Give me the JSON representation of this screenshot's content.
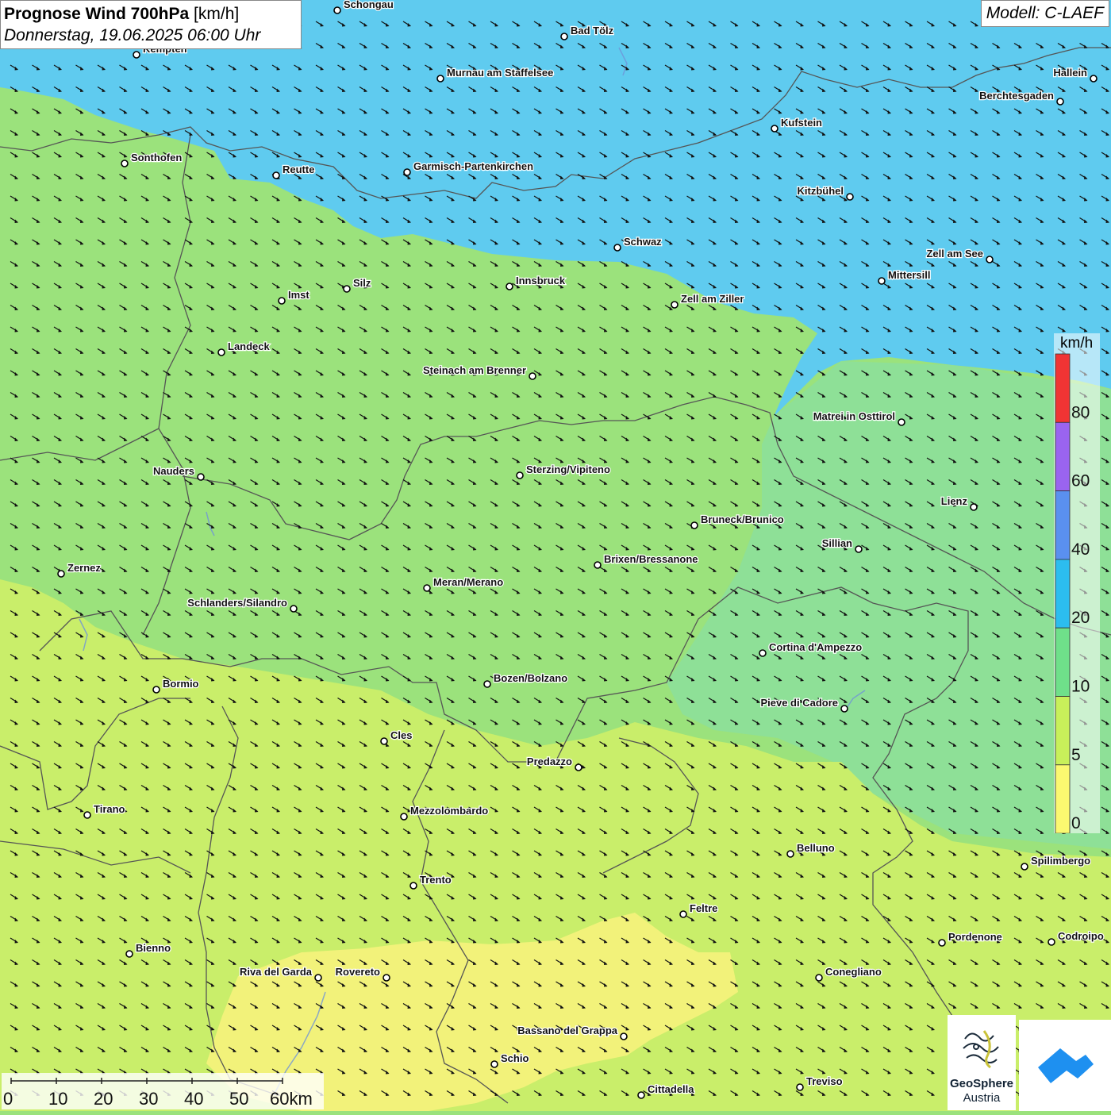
{
  "title": {
    "bold": "Prognose Wind 700hPa",
    "unit": "[km/h]",
    "date": "Donnerstag, 19.06.2025 06:00 Uhr"
  },
  "model": "Modell: C-LAEF",
  "legend": {
    "unit": "km/h",
    "ticks": [
      "80",
      "60",
      "40",
      "20",
      "10",
      "5",
      "0"
    ],
    "colors": [
      "#f03434",
      "#9a64f0",
      "#5a90ef",
      "#2cbdef",
      "#6fe08a",
      "#c8f05a",
      "#fbf870"
    ]
  },
  "scalebar": {
    "ticks": [
      "0",
      "10",
      "20",
      "30",
      "40",
      "50",
      "60km"
    ]
  },
  "logo": {
    "line1": "GeoSphere",
    "line2": "Austria"
  },
  "cities": [
    {
      "name": "Schongau"
    },
    {
      "name": "Bad Tölz"
    },
    {
      "name": "Kempten"
    },
    {
      "name": "Murnau am Staffelsee"
    },
    {
      "name": "Hallein"
    },
    {
      "name": "Berchtesgaden"
    },
    {
      "name": "Kufstein"
    },
    {
      "name": "Sonthofen"
    },
    {
      "name": "Reutte"
    },
    {
      "name": "Garmisch-Partenkirchen"
    },
    {
      "name": "Kitzbühel"
    },
    {
      "name": "Schwaz"
    },
    {
      "name": "Zell am See"
    },
    {
      "name": "Mittersill"
    },
    {
      "name": "Innsbruck"
    },
    {
      "name": "Silz"
    },
    {
      "name": "Imst"
    },
    {
      "name": "Zell am Ziller"
    },
    {
      "name": "Landeck"
    },
    {
      "name": "Steinach am Brenner"
    },
    {
      "name": "Matrei in Osttirol"
    },
    {
      "name": "Nauders"
    },
    {
      "name": "Sterzing/Vipiteno"
    },
    {
      "name": "Lienz"
    },
    {
      "name": "Bruneck/Brunico"
    },
    {
      "name": "Sillian"
    },
    {
      "name": "Brixen/Bressanone"
    },
    {
      "name": "Zernez"
    },
    {
      "name": "Meran/Merano"
    },
    {
      "name": "Schlanders/Silandro"
    },
    {
      "name": "Cortina d'Ampezzo"
    },
    {
      "name": "Bozen/Bolzano"
    },
    {
      "name": "Bormio"
    },
    {
      "name": "Pieve di Cadore"
    },
    {
      "name": "Cles"
    },
    {
      "name": "Predazzo"
    },
    {
      "name": "Tirano"
    },
    {
      "name": "Mezzolombardo"
    },
    {
      "name": "Belluno"
    },
    {
      "name": "Spilimbergo"
    },
    {
      "name": "Trento"
    },
    {
      "name": "Feltre"
    },
    {
      "name": "Bienno"
    },
    {
      "name": "Pordenone"
    },
    {
      "name": "Codroipo"
    },
    {
      "name": "Riva del Garda"
    },
    {
      "name": "Rovereto"
    },
    {
      "name": "Conegliano"
    },
    {
      "name": "Bassano del Grappa"
    },
    {
      "name": "Schio"
    },
    {
      "name": "Treviso"
    },
    {
      "name": "Cittadella"
    }
  ]
}
